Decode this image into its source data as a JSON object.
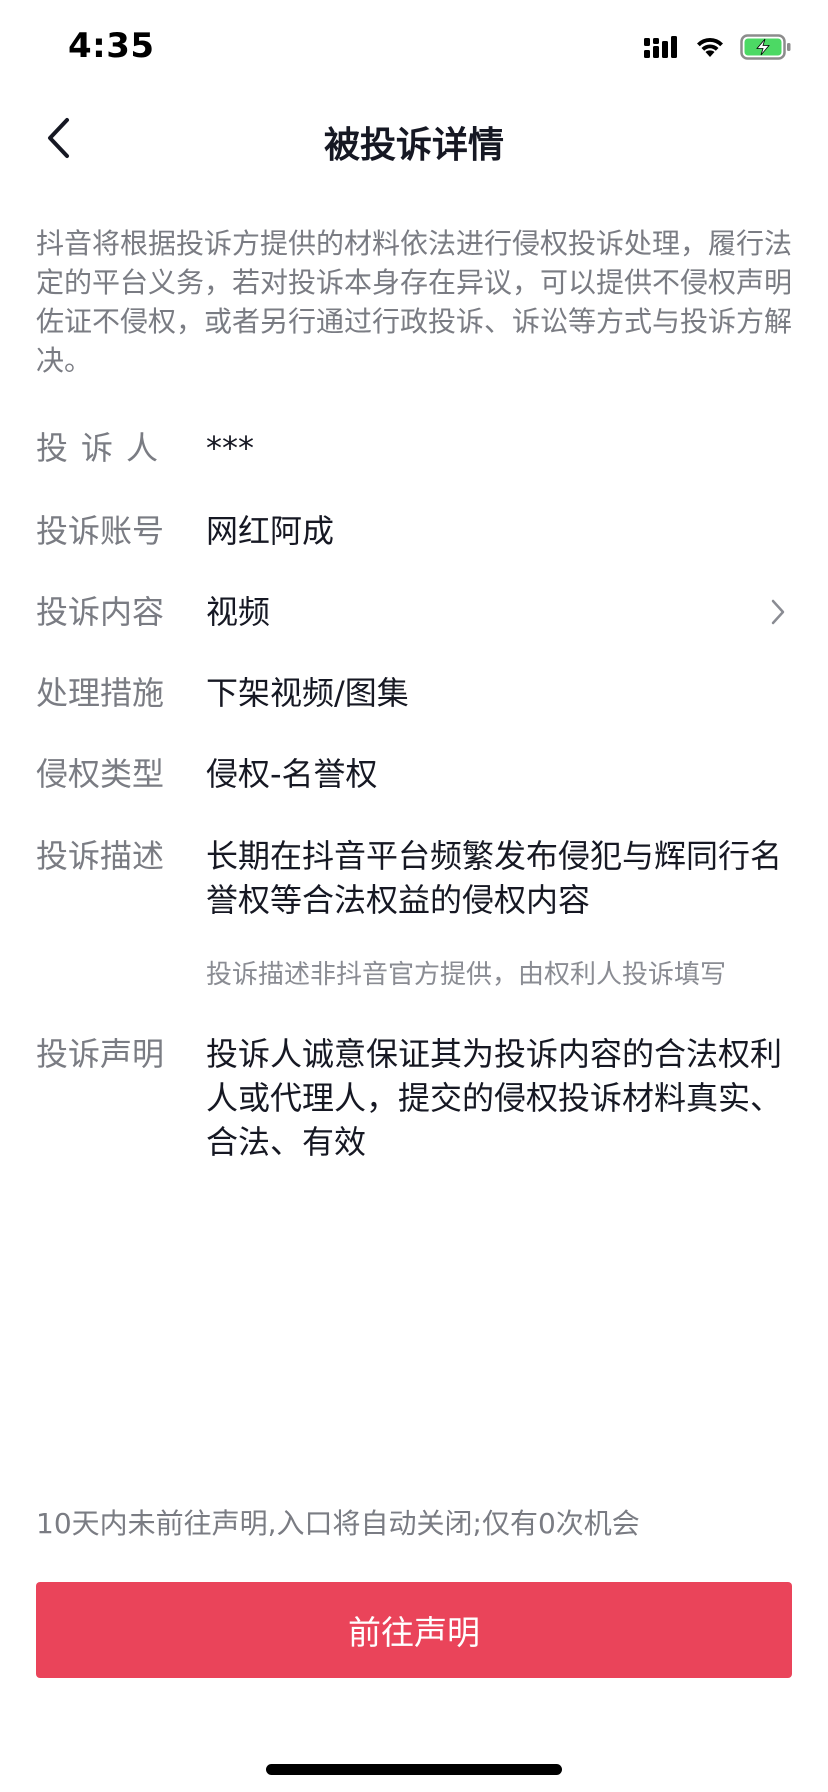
{
  "status_bar": {
    "time": "4:35",
    "icons": [
      "cellular-signal-icon",
      "wifi-icon",
      "battery-charging-icon"
    ],
    "battery_color": "#4cd964"
  },
  "nav": {
    "back_icon": "chevron-left-icon",
    "title": "被投诉详情"
  },
  "intro": "抖音将根据投诉方提供的材料依法进行侵权投诉处理，履行法定的平台义务，若对投诉本身存在异议，可以提供不侵权声明佐证不侵权，或者另行通过行政投诉、诉讼等方式与投诉方解决。",
  "details": {
    "complainant": {
      "label": "投诉人",
      "value": "***"
    },
    "account": {
      "label": "投诉账号",
      "value": "网红阿成"
    },
    "content": {
      "label": "投诉内容",
      "value": "视频",
      "icon": "chevron-right-icon"
    },
    "measure": {
      "label": "处理措施",
      "value": "下架视频/图集"
    },
    "infringement_type": {
      "label": "侵权类型",
      "value": "侵权-名誉权"
    },
    "description": {
      "label": "投诉描述",
      "value": "长期在抖音平台频繁发布侵犯与辉同行名誉权等合法权益的侵权内容",
      "note": "投诉描述非抖音官方提供，由权利人投诉填写"
    },
    "statement": {
      "label": "投诉声明",
      "value": "投诉人诚意保证其为投诉内容的合法权利人或代理人，提交的侵权投诉材料真实、合法、有效"
    }
  },
  "footer": {
    "notice": "10天内未前往声明,入口将自动关闭;仅有0次机会",
    "button_label": "前往声明",
    "button_color": "#ea445a"
  }
}
